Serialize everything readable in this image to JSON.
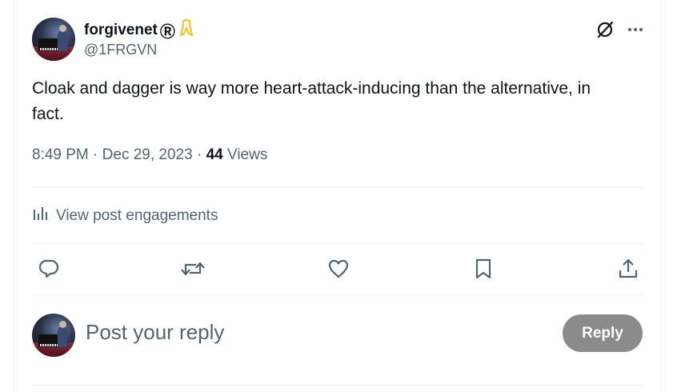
{
  "tweet": {
    "display_name": "forgivenet",
    "name_suffix": "Ⓡ",
    "handle": "@1FRGVN",
    "text": "Cloak and dagger is way more heart-attack-inducing than the alternative, in fact.",
    "time": "8:49 PM",
    "separator": "·",
    "date": "Dec 29, 2023",
    "views_count": "44",
    "views_label": "Views"
  },
  "engagements": {
    "label": "View post engagements"
  },
  "actions": {
    "reply_icon": "reply-icon",
    "repost_icon": "repost-icon",
    "like_icon": "like-icon",
    "bookmark_icon": "bookmark-icon",
    "share_icon": "share-icon"
  },
  "composer": {
    "placeholder": "Post your reply",
    "button_label": "Reply"
  },
  "colors": {
    "text_primary": "#0f1419",
    "text_secondary": "#536471",
    "divider": "#eff3f4",
    "reply_button_bg": "#8b8b8b",
    "ribbon": "#f4c542"
  }
}
